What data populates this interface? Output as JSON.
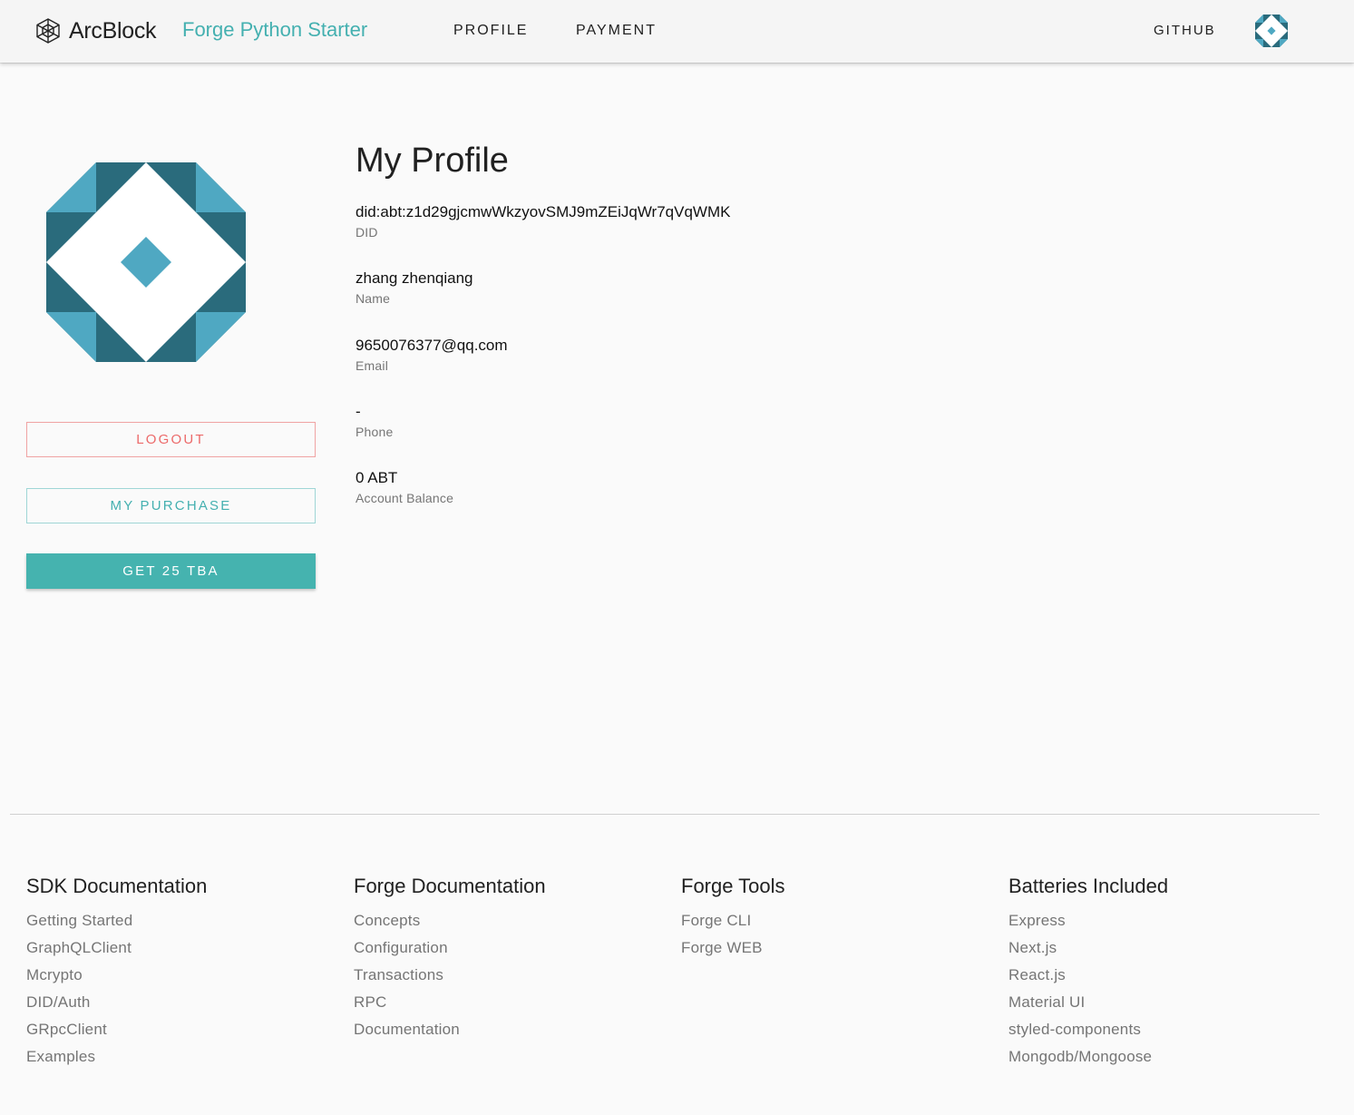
{
  "header": {
    "brand_name": "ArcBlock",
    "app_title": "Forge Python Starter",
    "nav": {
      "profile": "PROFILE",
      "payment": "PAYMENT",
      "github": "GITHUB"
    }
  },
  "sidebar": {
    "logout_label": "LOGOUT",
    "purchase_label": "MY PURCHASE",
    "get_tba_label": "GET 25 TBA"
  },
  "profile": {
    "title": "My Profile",
    "fields": [
      {
        "value": "did:abt:z1d29gjcmwWkzyovSMJ9mZEiJqWr7qVqWMK",
        "label": "DID"
      },
      {
        "value": "zhang zhenqiang",
        "label": "Name"
      },
      {
        "value": "9650076377@qq.com",
        "label": "Email"
      },
      {
        "value": "-",
        "label": "Phone"
      },
      {
        "value": "0 ABT",
        "label": "Account Balance"
      }
    ]
  },
  "footer": {
    "columns": [
      {
        "heading": "SDK Documentation",
        "links": [
          "Getting Started",
          "GraphQLClient",
          "Mcrypto",
          "DID/Auth",
          "GRpcClient",
          "Examples"
        ]
      },
      {
        "heading": "Forge Documentation",
        "links": [
          "Concepts",
          "Configuration",
          "Transactions",
          "RPC",
          "Documentation"
        ]
      },
      {
        "heading": "Forge Tools",
        "links": [
          "Forge CLI",
          "Forge WEB"
        ]
      },
      {
        "heading": "Batteries Included",
        "links": [
          "Express",
          "Next.js",
          "React.js",
          "Material UI",
          "styled-components",
          "Mongodb/Mongoose"
        ]
      }
    ]
  },
  "colors": {
    "accent": "#44b0b0",
    "logout": "#ec6a6a",
    "avatar_dark": "#2a6b7c",
    "avatar_light": "#4fa8c2"
  }
}
